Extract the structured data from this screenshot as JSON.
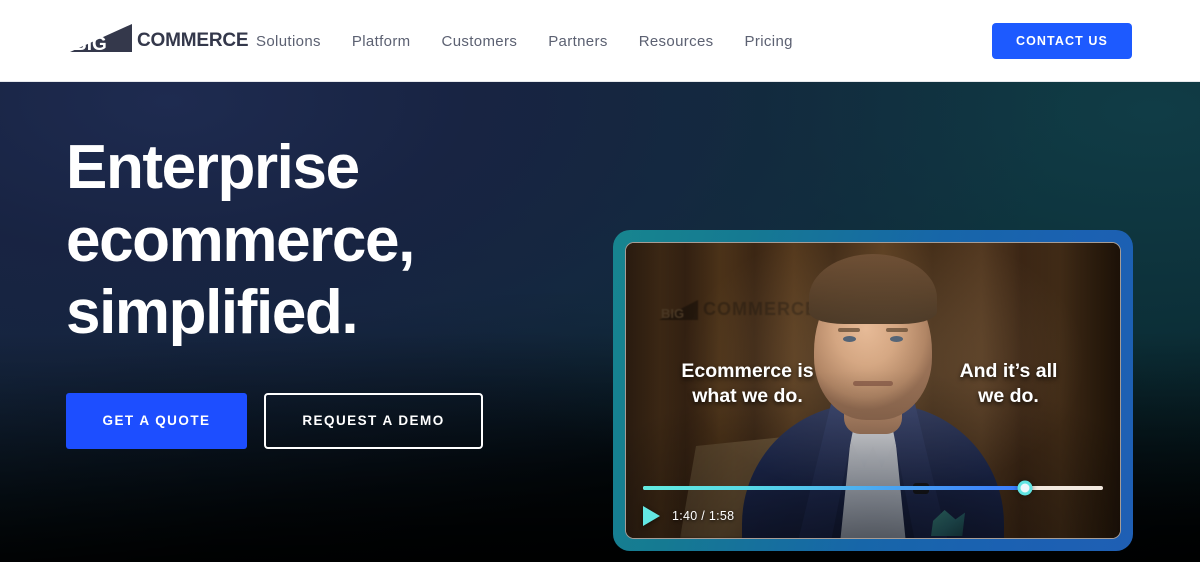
{
  "header": {
    "logo": {
      "mark": "bigcommerce-triangle-icon",
      "mark_text": "BIG",
      "word": "COMMERCE"
    },
    "nav": [
      {
        "label": "Solutions"
      },
      {
        "label": "Platform"
      },
      {
        "label": "Customers"
      },
      {
        "label": "Partners"
      },
      {
        "label": "Resources"
      },
      {
        "label": "Pricing"
      }
    ],
    "cta": {
      "label": "CONTACT US",
      "color": "#1d5aff"
    }
  },
  "hero": {
    "headline": {
      "line1": "Enterprise",
      "line2": "ecommerce,",
      "line3": "simplified."
    },
    "buttons": {
      "primary": {
        "label": "GET A QUOTE",
        "color": "#1d4eff"
      },
      "secondary": {
        "label": "REQUEST A DEMO",
        "border_color": "#ffffff"
      }
    },
    "background_colors": {
      "navy": "#17243f",
      "teal": "#0c2e38",
      "bottom": "#010406"
    }
  },
  "player": {
    "frame_gradient_start": "#17858f",
    "frame_gradient_end": "#1f5fb4",
    "wall_logo": {
      "mark_text": "BIG",
      "word": "COMMERCE"
    },
    "captions": {
      "left_line1": "Ecommerce is",
      "left_line2": "what we do.",
      "right_line1": "And it’s all",
      "right_line2": "we do."
    },
    "controls": {
      "play_icon": "play-triangle-icon",
      "current_time": "1:40",
      "separator": "/",
      "duration": "1:58",
      "time_display": "1:40 / 1:58",
      "progress_percent": 83,
      "fill_start_color": "#63ebe0",
      "fill_end_color": "#3b7bfd",
      "handle_color": "#5fe4e2"
    }
  }
}
